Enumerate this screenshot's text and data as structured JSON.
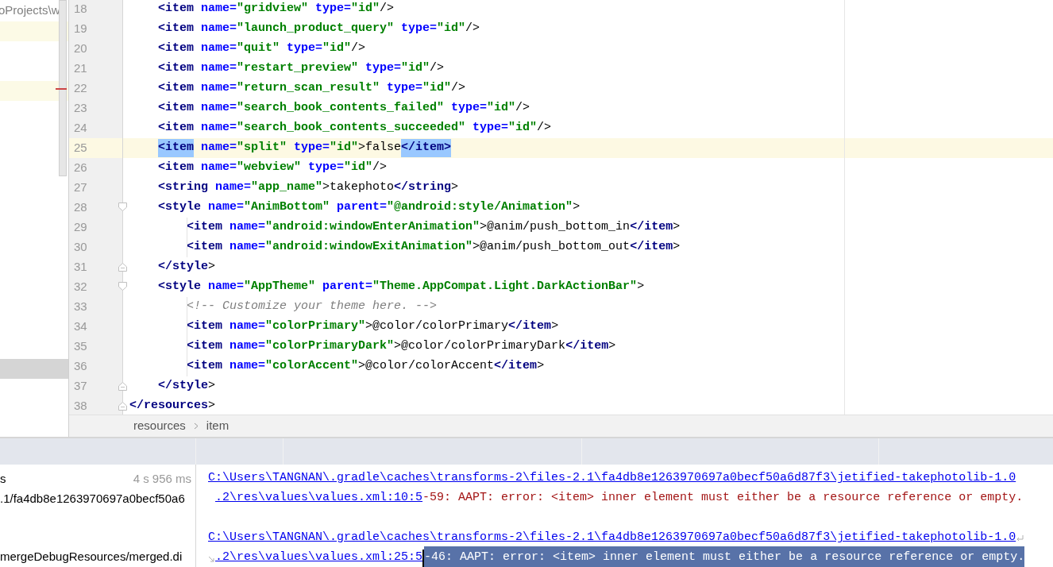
{
  "project_panel": {
    "rows": [
      {
        "text": "oProjects\\w",
        "changed": false,
        "selected": false
      },
      {
        "changed": true,
        "selected": false
      },
      {
        "changed": false,
        "selected": false
      },
      {
        "changed": false,
        "selected": false
      },
      {
        "changed": true,
        "selected": false
      },
      {
        "changed": false,
        "selected": false
      },
      {
        "changed": false,
        "selected": false
      },
      {
        "changed": false,
        "selected": false
      },
      {
        "changed": false,
        "selected": false
      },
      {
        "changed": false,
        "selected": false
      },
      {
        "changed": false,
        "selected": false
      },
      {
        "changed": false,
        "selected": false
      },
      {
        "changed": false,
        "selected": false
      },
      {
        "changed": false,
        "selected": false
      },
      {
        "changed": false,
        "selected": false
      },
      {
        "changed": false,
        "selected": false
      },
      {
        "changed": false,
        "selected": false
      },
      {
        "changed": false,
        "selected": false
      },
      {
        "changed": false,
        "selected": true
      }
    ]
  },
  "editor": {
    "lines": [
      {
        "number": "18",
        "current": false,
        "outdented": false,
        "tokens": [
          {
            "kind": "tag",
            "text": "<item"
          },
          {
            "kind": "attr",
            "text": " name="
          },
          {
            "kind": "val",
            "text": "\"gridview\""
          },
          {
            "kind": "attr",
            "text": " type="
          },
          {
            "kind": "val",
            "text": "\"id\""
          },
          {
            "kind": "p",
            "text": "/>"
          }
        ]
      },
      {
        "number": "19",
        "current": false,
        "outdented": false,
        "tokens": [
          {
            "kind": "tag",
            "text": "<item"
          },
          {
            "kind": "attr",
            "text": " name="
          },
          {
            "kind": "val",
            "text": "\"launch_product_query\""
          },
          {
            "kind": "attr",
            "text": " type="
          },
          {
            "kind": "val",
            "text": "\"id\""
          },
          {
            "kind": "p",
            "text": "/>"
          }
        ]
      },
      {
        "number": "20",
        "current": false,
        "outdented": false,
        "tokens": [
          {
            "kind": "tag",
            "text": "<item"
          },
          {
            "kind": "attr",
            "text": " name="
          },
          {
            "kind": "val",
            "text": "\"quit\""
          },
          {
            "kind": "attr",
            "text": " type="
          },
          {
            "kind": "val",
            "text": "\"id\""
          },
          {
            "kind": "p",
            "text": "/>"
          }
        ]
      },
      {
        "number": "21",
        "current": false,
        "outdented": false,
        "tokens": [
          {
            "kind": "tag",
            "text": "<item"
          },
          {
            "kind": "attr",
            "text": " name="
          },
          {
            "kind": "val",
            "text": "\"restart_preview\""
          },
          {
            "kind": "attr",
            "text": " type="
          },
          {
            "kind": "val",
            "text": "\"id\""
          },
          {
            "kind": "p",
            "text": "/>"
          }
        ]
      },
      {
        "number": "22",
        "current": false,
        "outdented": false,
        "tokens": [
          {
            "kind": "tag",
            "text": "<item"
          },
          {
            "kind": "attr",
            "text": " name="
          },
          {
            "kind": "val",
            "text": "\"return_scan_result\""
          },
          {
            "kind": "attr",
            "text": " type="
          },
          {
            "kind": "val",
            "text": "\"id\""
          },
          {
            "kind": "p",
            "text": "/>"
          }
        ]
      },
      {
        "number": "23",
        "current": false,
        "outdented": false,
        "tokens": [
          {
            "kind": "tag",
            "text": "<item"
          },
          {
            "kind": "attr",
            "text": " name="
          },
          {
            "kind": "val",
            "text": "\"search_book_contents_failed\""
          },
          {
            "kind": "attr",
            "text": " type="
          },
          {
            "kind": "val",
            "text": "\"id\""
          },
          {
            "kind": "p",
            "text": "/>"
          }
        ]
      },
      {
        "number": "24",
        "current": false,
        "outdented": false,
        "tokens": [
          {
            "kind": "tag",
            "text": "<item"
          },
          {
            "kind": "attr",
            "text": " name="
          },
          {
            "kind": "val",
            "text": "\"search_book_contents_succeeded\""
          },
          {
            "kind": "attr",
            "text": " type="
          },
          {
            "kind": "val",
            "text": "\"id\""
          },
          {
            "kind": "p",
            "text": "/>"
          }
        ]
      },
      {
        "number": "25",
        "current": true,
        "outdented": false,
        "tokens": [
          {
            "kind": "match",
            "text": "<item"
          },
          {
            "kind": "attr",
            "text": " name="
          },
          {
            "kind": "val",
            "text": "\"split\""
          },
          {
            "kind": "attr",
            "text": " type="
          },
          {
            "kind": "val",
            "text": "\"id\""
          },
          {
            "kind": "p",
            "text": ">"
          },
          {
            "kind": "text",
            "text": "false"
          },
          {
            "kind": "match",
            "text": "</item>"
          }
        ]
      },
      {
        "number": "26",
        "current": false,
        "outdented": false,
        "tokens": [
          {
            "kind": "tag",
            "text": "<item"
          },
          {
            "kind": "attr",
            "text": " name="
          },
          {
            "kind": "val",
            "text": "\"webview\""
          },
          {
            "kind": "attr",
            "text": " type="
          },
          {
            "kind": "val",
            "text": "\"id\""
          },
          {
            "kind": "p",
            "text": "/>"
          }
        ]
      },
      {
        "number": "27",
        "current": false,
        "outdented": false,
        "tokens": [
          {
            "kind": "tag",
            "text": "<string"
          },
          {
            "kind": "attr",
            "text": " name="
          },
          {
            "kind": "val",
            "text": "\"app_name\""
          },
          {
            "kind": "p",
            "text": ">"
          },
          {
            "kind": "text",
            "text": "takephoto"
          },
          {
            "kind": "tag",
            "text": "</string"
          },
          {
            "kind": "p",
            "text": ">"
          }
        ]
      },
      {
        "number": "28",
        "current": false,
        "outdented": false,
        "fold_start": true,
        "fold_end": false,
        "tokens": [
          {
            "kind": "tag",
            "text": "<style"
          },
          {
            "kind": "attr",
            "text": " name="
          },
          {
            "kind": "val",
            "text": "\"AnimBottom\""
          },
          {
            "kind": "attr",
            "text": " parent="
          },
          {
            "kind": "val",
            "text": "\"@android:style/Animation\""
          },
          {
            "kind": "p",
            "text": ">"
          }
        ],
        "children": [
          {
            "number": "29",
            "current": false,
            "tokens": [
              {
                "kind": "tag",
                "text": "<item"
              },
              {
                "kind": "attr",
                "text": " name="
              },
              {
                "kind": "val",
                "text": "\"android:windowEnterAnimation\""
              },
              {
                "kind": "p",
                "text": ">"
              },
              {
                "kind": "text",
                "text": "@anim/push_bottom_in"
              },
              {
                "kind": "tag",
                "text": "</item"
              },
              {
                "kind": "p",
                "text": ">"
              }
            ]
          },
          {
            "number": "30",
            "current": false,
            "tokens": [
              {
                "kind": "tag",
                "text": "<item"
              },
              {
                "kind": "attr",
                "text": " name="
              },
              {
                "kind": "val",
                "text": "\"android:windowExitAnimation\""
              },
              {
                "kind": "p",
                "text": ">"
              },
              {
                "kind": "text",
                "text": "@anim/push_bottom_out"
              },
              {
                "kind": "tag",
                "text": "</item"
              },
              {
                "kind": "p",
                "text": ">"
              }
            ]
          }
        ]
      },
      {
        "number": "31",
        "current": false,
        "outdented": false,
        "fold_start": false,
        "fold_end": true,
        "tokens": [
          {
            "kind": "tag",
            "text": "</style"
          },
          {
            "kind": "p",
            "text": ">"
          }
        ]
      },
      {
        "number": "32",
        "current": false,
        "outdented": false,
        "fold_start": true,
        "fold_end": false,
        "tokens": [
          {
            "kind": "tag",
            "text": "<style"
          },
          {
            "kind": "attr",
            "text": " name="
          },
          {
            "kind": "val",
            "text": "\"AppTheme\""
          },
          {
            "kind": "attr",
            "text": " parent="
          },
          {
            "kind": "val",
            "text": "\"Theme.AppCompat.Light.DarkActionBar\""
          },
          {
            "kind": "p",
            "text": ">"
          }
        ],
        "children": [
          {
            "number": "33",
            "current": false,
            "tokens": [
              {
                "kind": "comment",
                "text": "<!-- Customize your theme here. -->"
              }
            ]
          },
          {
            "number": "34",
            "current": false,
            "tokens": [
              {
                "kind": "tag",
                "text": "<item"
              },
              {
                "kind": "attr",
                "text": " name="
              },
              {
                "kind": "val",
                "text": "\"colorPrimary\""
              },
              {
                "kind": "p",
                "text": ">"
              },
              {
                "kind": "text",
                "text": "@color/colorPrimary"
              },
              {
                "kind": "tag",
                "text": "</item"
              },
              {
                "kind": "p",
                "text": ">"
              }
            ]
          },
          {
            "number": "35",
            "current": false,
            "tokens": [
              {
                "kind": "tag",
                "text": "<item"
              },
              {
                "kind": "attr",
                "text": " name="
              },
              {
                "kind": "val",
                "text": "\"colorPrimaryDark\""
              },
              {
                "kind": "p",
                "text": ">"
              },
              {
                "kind": "text",
                "text": "@color/colorPrimaryDark"
              },
              {
                "kind": "tag",
                "text": "</item"
              },
              {
                "kind": "p",
                "text": ">"
              }
            ]
          },
          {
            "number": "36",
            "current": false,
            "tokens": [
              {
                "kind": "tag",
                "text": "<item"
              },
              {
                "kind": "attr",
                "text": " name="
              },
              {
                "kind": "val",
                "text": "\"colorAccent\""
              },
              {
                "kind": "p",
                "text": ">"
              },
              {
                "kind": "text",
                "text": "@color/colorAccent"
              },
              {
                "kind": "tag",
                "text": "</item"
              },
              {
                "kind": "p",
                "text": ">"
              }
            ]
          }
        ]
      },
      {
        "number": "37",
        "current": false,
        "outdented": false,
        "fold_start": false,
        "fold_end": true,
        "tokens": [
          {
            "kind": "tag",
            "text": "</style"
          },
          {
            "kind": "p",
            "text": ">"
          }
        ]
      },
      {
        "number": "38",
        "current": false,
        "outdented": true,
        "fold_start": false,
        "fold_end": true,
        "tokens": [
          {
            "kind": "tag",
            "text": "</resources"
          },
          {
            "kind": "p",
            "text": ">"
          }
        ]
      }
    ]
  },
  "breadcrumb": [
    "resources",
    "item"
  ],
  "build_panel": {
    "items": [
      {
        "label": "s",
        "time": "4 s 956 ms"
      },
      {
        "label": ".1/fa4db8e1263970697a0becf50a6"
      },
      {
        "label": "mergeDebugResources/merged.di"
      }
    ]
  },
  "console": {
    "messages": [
      {
        "path": "C:\\Users\\TANGNAN\\.gradle\\caches\\transforms-2\\files-2.1\\fa4db8e1263970697a0becf50a6d87f3\\jetified-takephotolib-1.0",
        "location": ".2\\res\\values\\values.xml:10:5",
        "message": "-59: AAPT: error: <item> inner element must either be a resource reference or empty.",
        "selected": false,
        "wrap_icon": false
      },
      {
        "path": "C:\\Users\\TANGNAN\\.gradle\\caches\\transforms-2\\files-2.1\\fa4db8e1263970697a0becf50a6d87f3\\jetified-takephotolib-1.0",
        "location": ".2\\res\\values\\values.xml:25:5",
        "message": "-46: AAPT: error: <item> inner element must either be a resource reference or empty.",
        "selected": true,
        "wrap_icon": true
      }
    ]
  }
}
